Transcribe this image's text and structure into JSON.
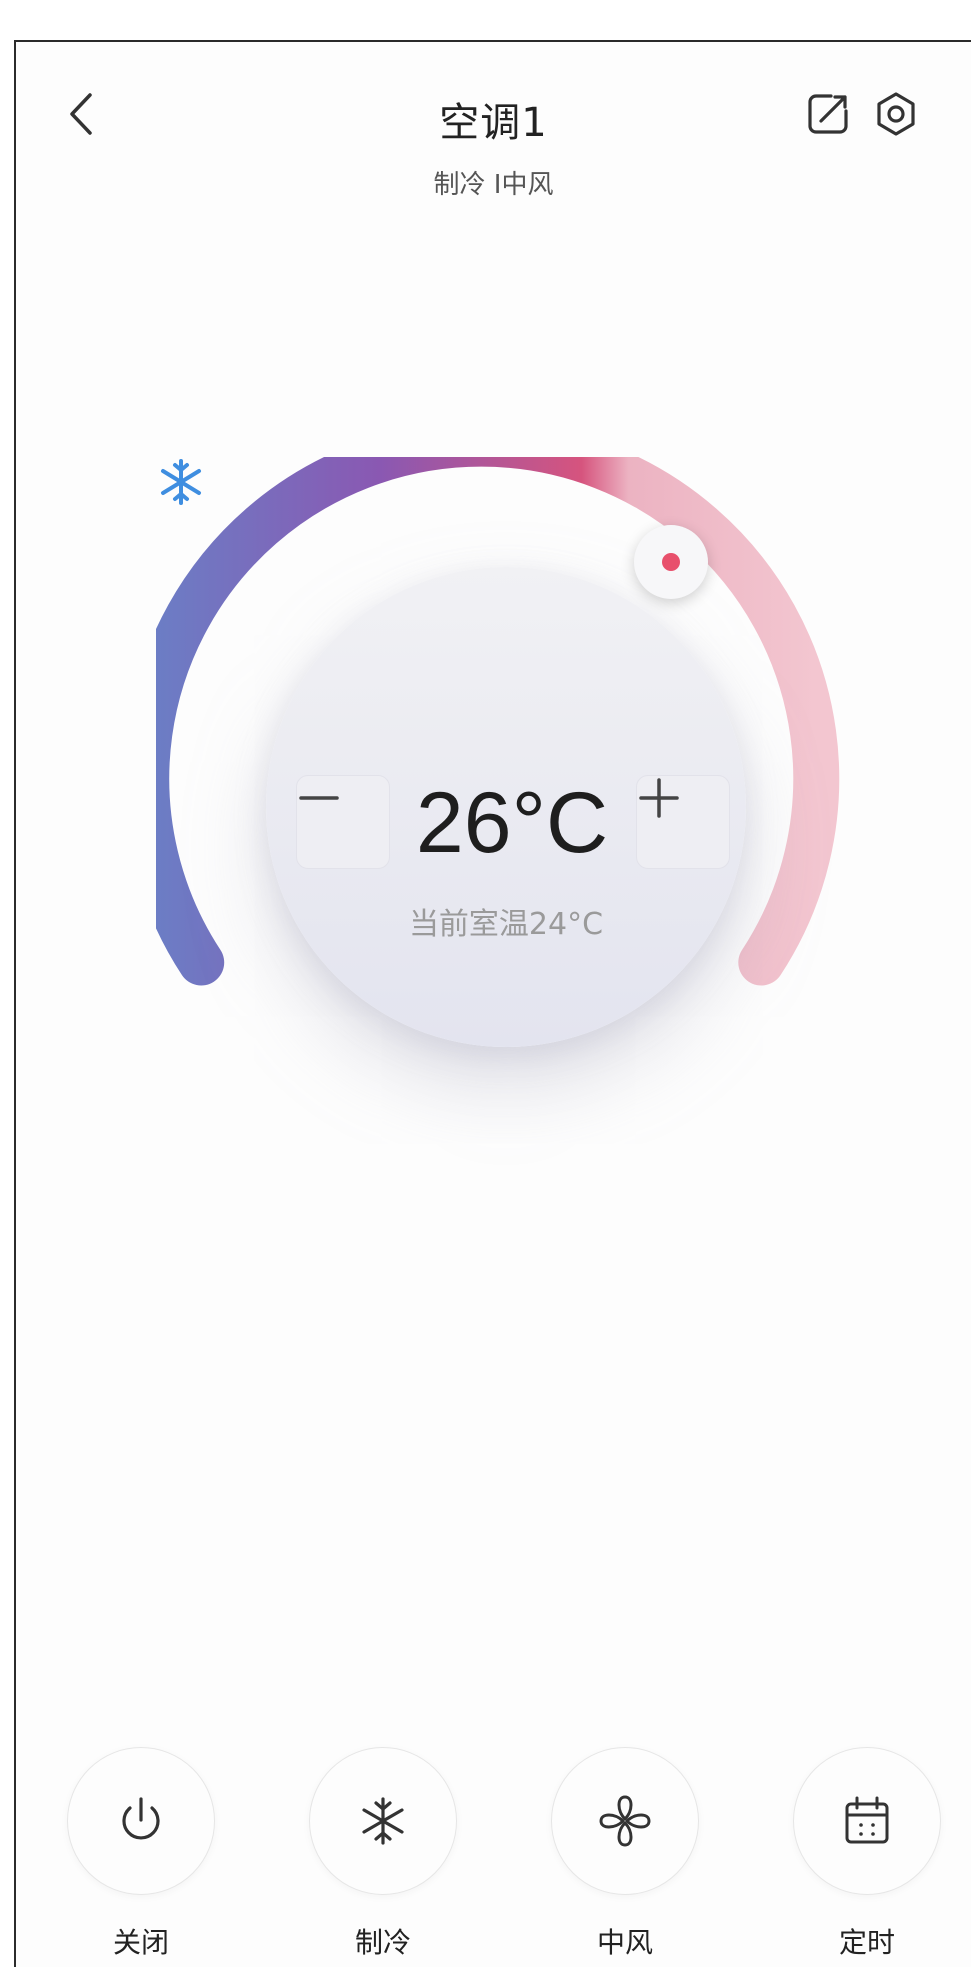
{
  "header": {
    "title": "空调1",
    "subtitle": "制冷 I中风"
  },
  "dial": {
    "setpoint": "26°C",
    "room_temperature": "当前室温24°C",
    "mode_icon": "snowflake-icon",
    "gradient_colors": [
      "#6a7ec4",
      "#8d5bb0",
      "#d8577d",
      "#f3c4ce"
    ],
    "knob_color": "#e8506c",
    "snow_color": "#3f8ee0"
  },
  "controls": [
    {
      "label": "关闭",
      "icon": "power-icon"
    },
    {
      "label": "制冷",
      "icon": "snowflake-icon"
    },
    {
      "label": "中风",
      "icon": "fan-icon"
    },
    {
      "label": "定时",
      "icon": "calendar-icon"
    }
  ]
}
